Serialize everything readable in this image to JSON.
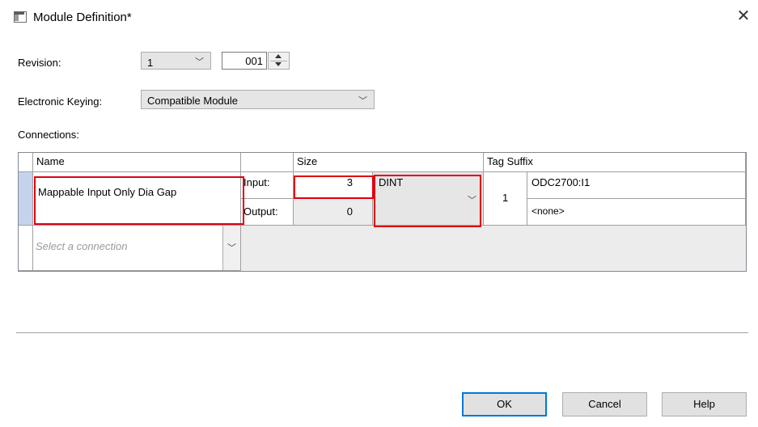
{
  "window": {
    "title": "Module Definition*"
  },
  "revision": {
    "label": "Revision:",
    "major": "1",
    "minor": "001"
  },
  "keying": {
    "label": "Electronic Keying:",
    "value": "Compatible Module"
  },
  "connections": {
    "label": "Connections:",
    "headers": {
      "name": "Name",
      "size": "Size",
      "tag_suffix": "Tag Suffix"
    },
    "row": {
      "name": "Mappable Input Only Dia Gap",
      "input_label": "Input:",
      "input_size": "3",
      "output_label": "Output:",
      "output_size": "0",
      "data_type": "DINT",
      "tag_num": "1",
      "input_tag": "ODC2700:I1",
      "output_tag": "<none>"
    },
    "new_row_placeholder": "Select a connection"
  },
  "buttons": {
    "ok": "OK",
    "cancel": "Cancel",
    "help": "Help"
  },
  "colors": {
    "highlight_box": "#e0000f",
    "selected_row": "#c4d4ec",
    "default_button_border": "#0078d7"
  }
}
